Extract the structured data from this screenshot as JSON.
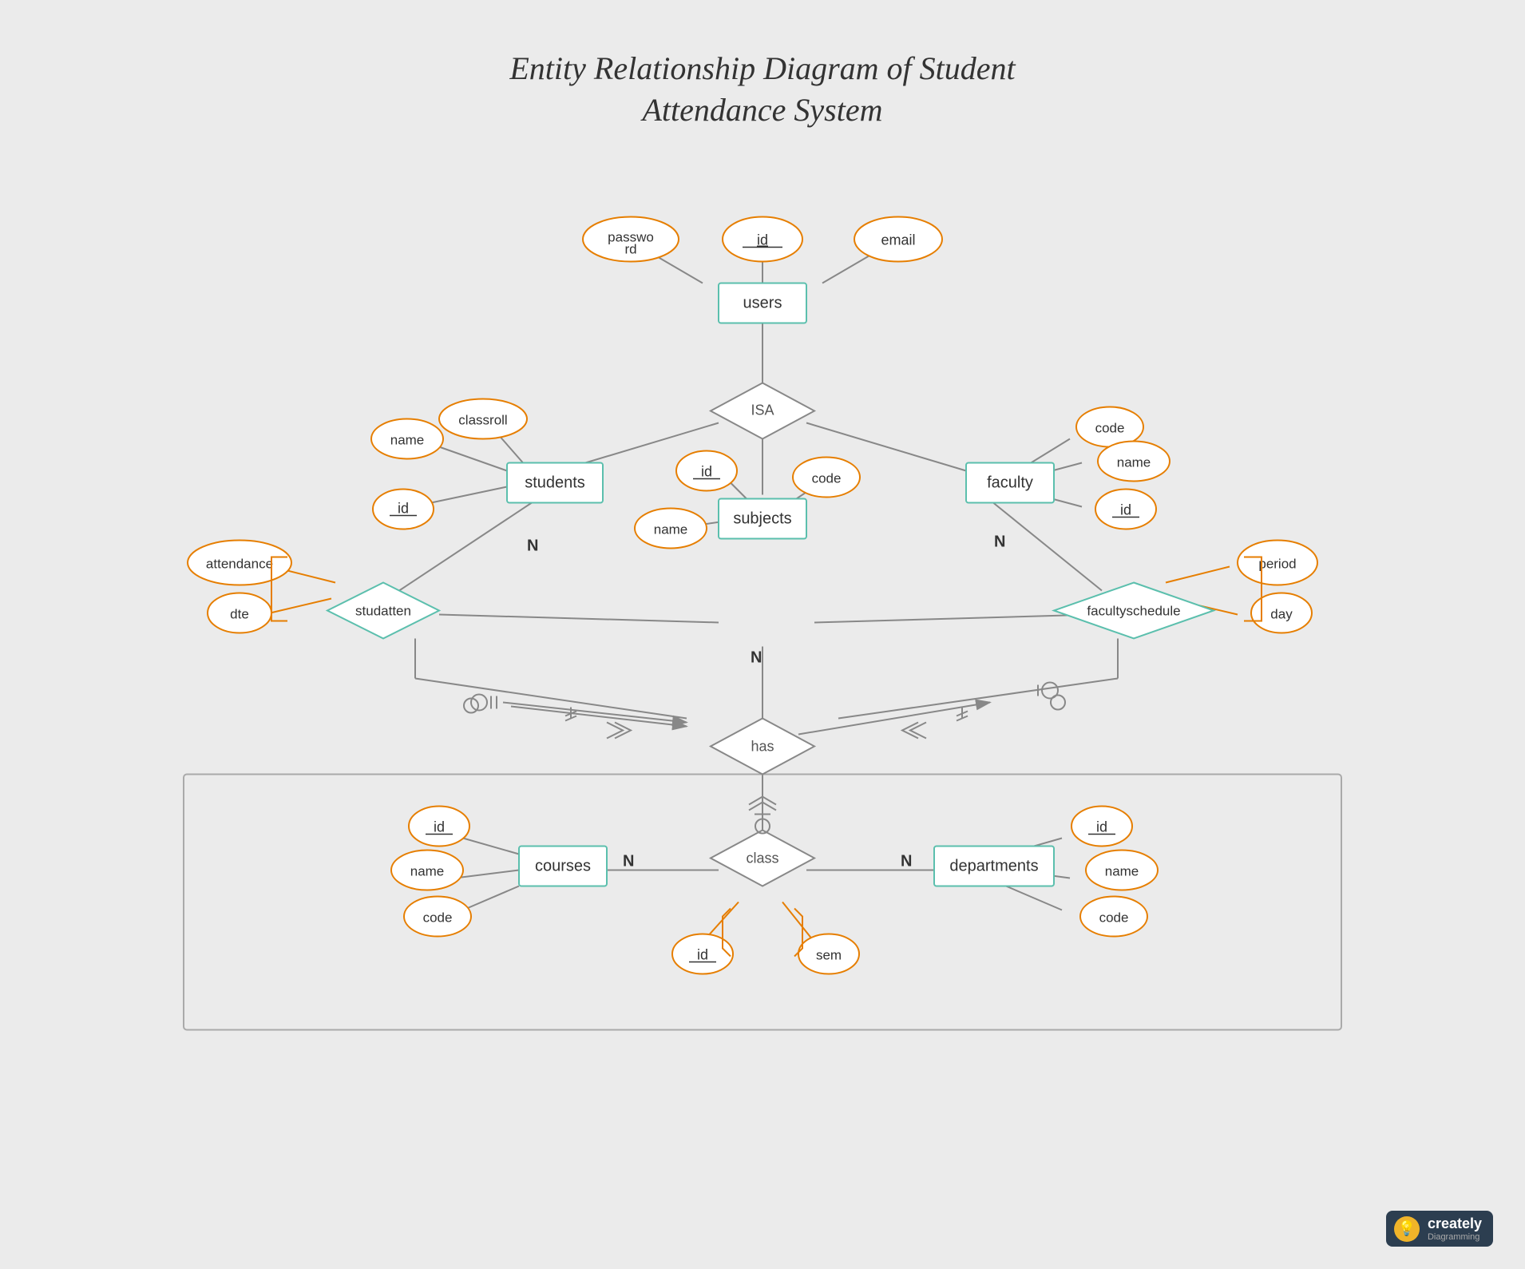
{
  "title": {
    "line1": "Entity Relationship Diagram of Student",
    "line2": "Attendance System"
  },
  "badge": {
    "name": "creately",
    "sub": "Diagramming"
  },
  "entities": {
    "users": "users",
    "students": "students",
    "faculty": "faculty",
    "subjects": "subjects",
    "courses": "courses",
    "departments": "departments",
    "class": "class"
  },
  "relationships": {
    "isa": "ISA",
    "studatten": "studatten",
    "has": "has",
    "facultyschedule": "facultyschedule"
  },
  "attributes": {
    "users_id": "id",
    "users_password": "password",
    "users_email": "email",
    "students_name": "name",
    "students_classroll": "classroll",
    "students_id": "id",
    "faculty_code": "code",
    "faculty_name": "name",
    "faculty_id": "id",
    "subjects_id": "id",
    "subjects_name": "name",
    "subjects_code": "code",
    "studatten_attendance": "attendance",
    "studatten_dte": "dte",
    "facultyschedule_period": "period",
    "facultyschedule_day": "day",
    "courses_id": "id",
    "courses_name": "name",
    "courses_code": "code",
    "departments_id": "id",
    "departments_name": "name",
    "departments_code": "code",
    "class_id": "id",
    "class_sem": "sem"
  },
  "cardinalities": {
    "n_students": "N",
    "n_faculty": "N",
    "n_subjects": "N",
    "n_courses": "N",
    "n_departments": "N"
  }
}
